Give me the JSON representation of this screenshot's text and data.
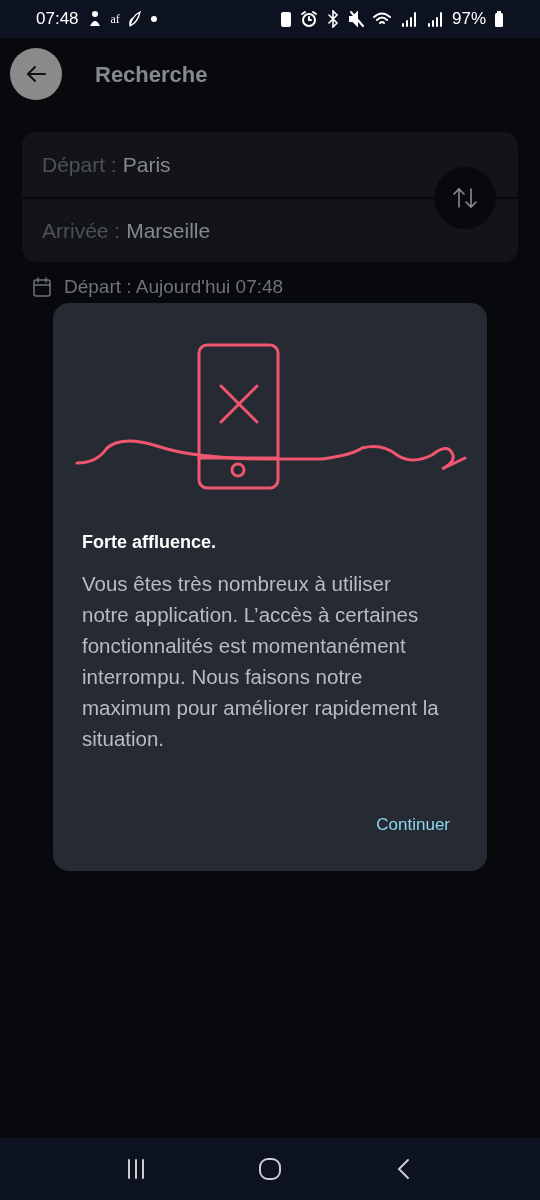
{
  "status_bar": {
    "time": "07:48",
    "notification_text": "af",
    "battery": "97%"
  },
  "header": {
    "title": "Recherche"
  },
  "route": {
    "fields": [
      {
        "label": "Départ :",
        "value": "Paris"
      },
      {
        "label": "Arrivée :",
        "value": "Marseille"
      }
    ]
  },
  "date_line": "Départ : Aujourd'hui 07:48",
  "dialog": {
    "title": "Forte affluence.",
    "message": "Vous êtes très nombreux à utiliser notre application. L’accès à certaines fonctionnalités est momentanément interrompu. Nous faisons notre maximum pour améliorer rapidement la situation.",
    "action": "Continuer"
  }
}
